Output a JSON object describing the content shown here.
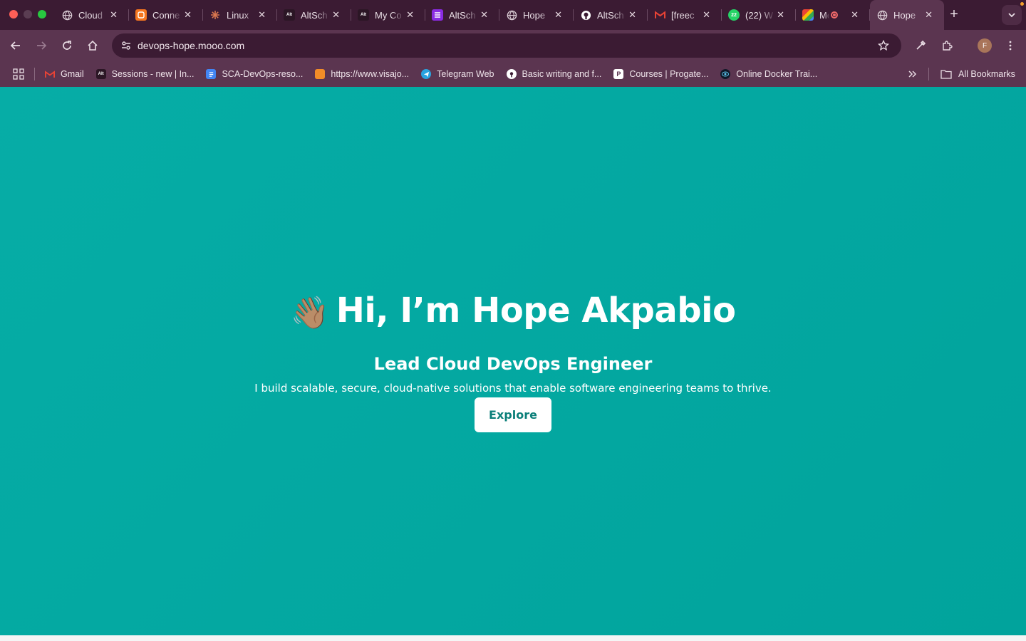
{
  "browser": {
    "tabs": [
      {
        "title": "Cloud",
        "icon": "openai-icon",
        "color": "#e0d5dc"
      },
      {
        "title": "Conne",
        "icon": "conn-icon",
        "color": "#f4751f"
      },
      {
        "title": "Linux",
        "icon": "claude-icon",
        "color": "#d9774f"
      },
      {
        "title": "AltSch",
        "icon": "altschool-icon",
        "color": "#2b1625"
      },
      {
        "title": "My Co",
        "icon": "altschool-icon",
        "color": "#2b1625"
      },
      {
        "title": "AltSch",
        "icon": "list-icon",
        "color": "#8a2be2"
      },
      {
        "title": "Hope",
        "icon": "globe-icon",
        "color": "#e0d5dc"
      },
      {
        "title": "AltSch",
        "icon": "github-icon",
        "color": "#ffffff"
      },
      {
        "title": "[freec",
        "icon": "gmail-icon",
        "color": "#ea4335"
      },
      {
        "title": "(22) W",
        "icon": "whatsapp-icon",
        "color": "#25d366"
      },
      {
        "title": "Me",
        "icon": "meet-icon",
        "color": "#34a853"
      },
      {
        "title": "Hope",
        "icon": "globe-icon",
        "color": "#e0d5dc",
        "active": true
      }
    ],
    "address": "devops-hope.mooo.com",
    "profile_initial": "F"
  },
  "bookmarks": {
    "items": [
      {
        "label": "Gmail",
        "icon": "gmail-icon",
        "color": "#ea4335"
      },
      {
        "label": "Sessions - new | In...",
        "icon": "altschool-icon",
        "color": "#2b1625"
      },
      {
        "label": "SCA-DevOps-reso...",
        "icon": "docs-icon",
        "color": "#4285f4"
      },
      {
        "label": "https://www.visajo...",
        "icon": "visa-icon",
        "color": "#f28c28"
      },
      {
        "label": "Telegram Web",
        "icon": "telegram-icon",
        "color": "#2aa3e0"
      },
      {
        "label": "Basic writing and f...",
        "icon": "github-icon",
        "color": "#ffffff"
      },
      {
        "label": "Courses | Progate...",
        "icon": "progate-icon",
        "color": "#ffffff"
      },
      {
        "label": "Online Docker Trai...",
        "icon": "docker-eye-icon",
        "color": "#101828"
      }
    ],
    "all_label": "All Bookmarks"
  },
  "hero": {
    "wave": "👋🏽",
    "greeting": "Hi, I’m Hope Akpabio",
    "role": "Lead Cloud DevOps Engineer",
    "tagline": "I build scalable, secure, cloud-native solutions that enable software engineering teams to thrive.",
    "button_label": "Explore"
  },
  "colors": {
    "accent": "#04a8a1",
    "browser_frame": "#5b3550"
  }
}
